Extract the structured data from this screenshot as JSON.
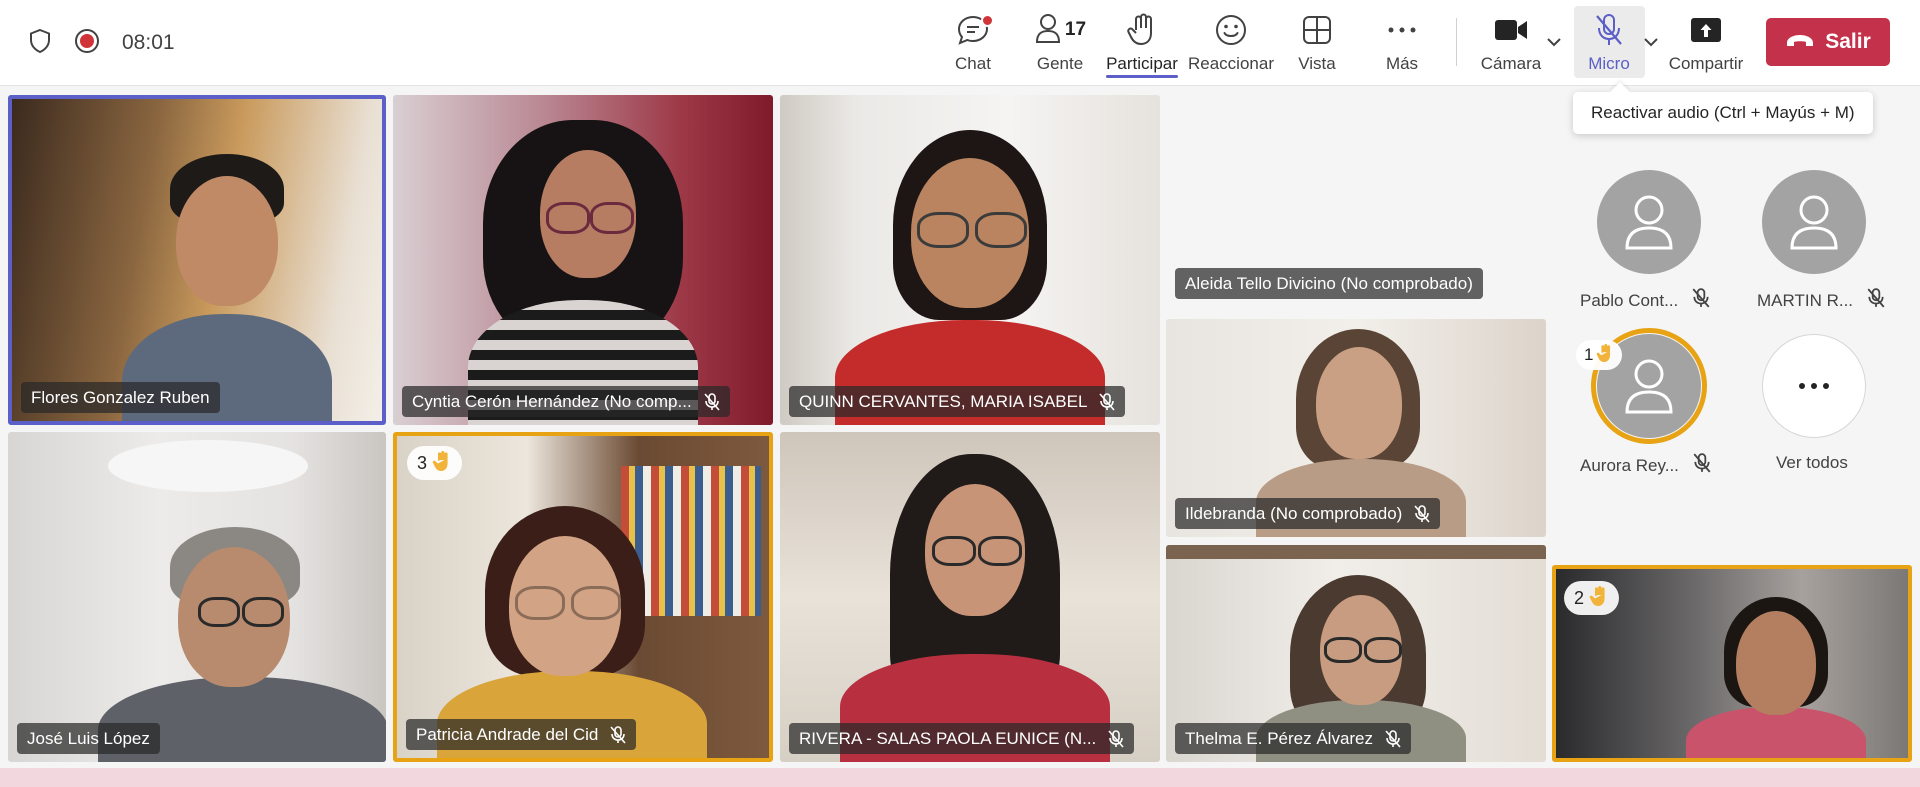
{
  "topbar": {
    "timer": "08:01",
    "chat_label": "Chat",
    "people_label": "Gente",
    "people_count": "17",
    "participate_label": "Participar",
    "react_label": "Reaccionar",
    "view_label": "Vista",
    "more_label": "Más",
    "camera_label": "Cámara",
    "mic_label": "Micro",
    "share_label": "Compartir",
    "leave_label": "Salir"
  },
  "tooltip": "Reactivar audio (Ctrl + Mayús + M)",
  "tiles": {
    "t1": {
      "name": "Flores Gonzalez Ruben"
    },
    "t2": {
      "name": "Cyntia Cerón Hernández (No comp..."
    },
    "t3": {
      "name": "QUINN CERVANTES, MARIA ISABEL"
    },
    "t4": {
      "name": "Aleida Tello Divicino (No comprobado)"
    },
    "t5": {
      "name": "Ildebranda (No comprobado)"
    },
    "t6": {
      "name": "José Luis López"
    },
    "t7": {
      "name": "Patricia Andrade del Cid",
      "hand": "3"
    },
    "t8": {
      "name": "RIVERA - SALAS PAOLA EUNICE (N..."
    },
    "t9": {
      "name": "Thelma E. Pérez Álvarez"
    },
    "t10": {
      "hand": "2"
    }
  },
  "roster": {
    "p1": "Pablo Cont...",
    "p2": "MARTIN R...",
    "p3": "Aurora Rey...",
    "p3_hand": "1",
    "see_all": "Ver todos"
  },
  "colors": {
    "accent": "#5b5fc7",
    "leave": "#c4314b",
    "raised_hand_border": "#e8a314"
  }
}
